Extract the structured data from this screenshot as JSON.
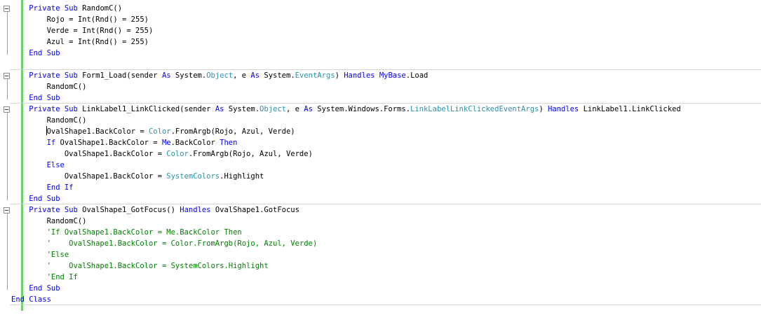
{
  "editor": {
    "lines": [
      [
        {
          "t": "    ",
          "c": "tx"
        },
        {
          "t": "Private Sub",
          "c": "kw"
        },
        {
          "t": " RandomC()",
          "c": "tx"
        }
      ],
      [
        {
          "t": "        Rojo = Int(Rnd() = 255)",
          "c": "tx"
        }
      ],
      [
        {
          "t": "        Verde = Int(Rnd() = 255)",
          "c": "tx"
        }
      ],
      [
        {
          "t": "        Azul = Int(Rnd() = 255)",
          "c": "tx"
        }
      ],
      [
        {
          "t": "    ",
          "c": "tx"
        },
        {
          "t": "End Sub",
          "c": "kw"
        }
      ],
      [],
      [
        {
          "t": "    ",
          "c": "tx"
        },
        {
          "t": "Private Sub",
          "c": "kw"
        },
        {
          "t": " Form1_Load(sender ",
          "c": "tx"
        },
        {
          "t": "As",
          "c": "kw"
        },
        {
          "t": " System.",
          "c": "tx"
        },
        {
          "t": "Object",
          "c": "ty"
        },
        {
          "t": ", e ",
          "c": "tx"
        },
        {
          "t": "As",
          "c": "kw"
        },
        {
          "t": " System.",
          "c": "tx"
        },
        {
          "t": "EventArgs",
          "c": "ty"
        },
        {
          "t": ") ",
          "c": "tx"
        },
        {
          "t": "Handles",
          "c": "kw"
        },
        {
          "t": " ",
          "c": "tx"
        },
        {
          "t": "MyBase",
          "c": "kw"
        },
        {
          "t": ".Load",
          "c": "tx"
        }
      ],
      [
        {
          "t": "        RandomC()",
          "c": "tx"
        }
      ],
      [
        {
          "t": "    ",
          "c": "tx"
        },
        {
          "t": "End Sub",
          "c": "kw"
        }
      ],
      [
        {
          "t": "    ",
          "c": "tx"
        },
        {
          "t": "Private Sub",
          "c": "kw"
        },
        {
          "t": " LinkLabel1_LinkClicked(sender ",
          "c": "tx"
        },
        {
          "t": "As",
          "c": "kw"
        },
        {
          "t": " System.",
          "c": "tx"
        },
        {
          "t": "Object",
          "c": "ty"
        },
        {
          "t": ", e ",
          "c": "tx"
        },
        {
          "t": "As",
          "c": "kw"
        },
        {
          "t": " System.Windows.Forms.",
          "c": "tx"
        },
        {
          "t": "LinkLabelLinkClickedEventArgs",
          "c": "ty"
        },
        {
          "t": ") ",
          "c": "tx"
        },
        {
          "t": "Handles",
          "c": "kw"
        },
        {
          "t": " LinkLabel1.LinkClicked",
          "c": "tx"
        }
      ],
      [
        {
          "t": "        RandomC()",
          "c": "tx"
        }
      ],
      [
        {
          "t": "        ",
          "c": "tx"
        },
        {
          "t": "CARET",
          "c": "caret"
        },
        {
          "t": "OvalShape1.BackColor = ",
          "c": "tx"
        },
        {
          "t": "Color",
          "c": "ty"
        },
        {
          "t": ".FromArgb(Rojo, Azul, Verde)",
          "c": "tx"
        }
      ],
      [
        {
          "t": "        ",
          "c": "tx"
        },
        {
          "t": "If",
          "c": "kw"
        },
        {
          "t": " OvalShape1.BackColor = ",
          "c": "tx"
        },
        {
          "t": "Me",
          "c": "kw"
        },
        {
          "t": ".BackColor ",
          "c": "tx"
        },
        {
          "t": "Then",
          "c": "kw"
        }
      ],
      [
        {
          "t": "            OvalShape1.BackColor = ",
          "c": "tx"
        },
        {
          "t": "Color",
          "c": "ty"
        },
        {
          "t": ".FromArgb(Rojo, Azul, Verde)",
          "c": "tx"
        }
      ],
      [
        {
          "t": "        ",
          "c": "tx"
        },
        {
          "t": "Else",
          "c": "kw"
        }
      ],
      [
        {
          "t": "            OvalShape1.BackColor = ",
          "c": "tx"
        },
        {
          "t": "SystemColors",
          "c": "ty"
        },
        {
          "t": ".Highlight",
          "c": "tx"
        }
      ],
      [
        {
          "t": "        ",
          "c": "tx"
        },
        {
          "t": "End If",
          "c": "kw"
        }
      ],
      [
        {
          "t": "    ",
          "c": "tx"
        },
        {
          "t": "End Sub",
          "c": "kw"
        }
      ],
      [
        {
          "t": "    ",
          "c": "tx"
        },
        {
          "t": "Private Sub",
          "c": "kw"
        },
        {
          "t": " OvalShape1_GotFocus() ",
          "c": "tx"
        },
        {
          "t": "Handles",
          "c": "kw"
        },
        {
          "t": " OvalShape1.GotFocus",
          "c": "tx"
        }
      ],
      [
        {
          "t": "        RandomC()",
          "c": "tx"
        }
      ],
      [
        {
          "t": "        ",
          "c": "tx"
        },
        {
          "t": "'If OvalShape1.BackColor = Me.BackColor Then",
          "c": "cm"
        }
      ],
      [
        {
          "t": "        ",
          "c": "tx"
        },
        {
          "t": "'    OvalShape1.BackColor = Color.FromArgb(Rojo, Azul, Verde)",
          "c": "cm"
        }
      ],
      [
        {
          "t": "        ",
          "c": "tx"
        },
        {
          "t": "'Else",
          "c": "cm"
        }
      ],
      [
        {
          "t": "        ",
          "c": "tx"
        },
        {
          "t": "'    OvalShape1.BackColor = SystemColors.Highlight",
          "c": "cm"
        }
      ],
      [
        {
          "t": "        ",
          "c": "tx"
        },
        {
          "t": "'End If",
          "c": "cm"
        }
      ],
      [
        {
          "t": "    ",
          "c": "tx"
        },
        {
          "t": "End Sub",
          "c": "kw"
        }
      ],
      [
        {
          "t": "End Class",
          "c": "kw"
        }
      ]
    ],
    "collapsible_lines": [
      0,
      6,
      9,
      18
    ],
    "separator_after_lines": [
      5,
      8,
      17,
      26
    ],
    "colors": {
      "keyword": "#0000ff",
      "type": "#2b91af",
      "comment": "#008000",
      "text": "#000000",
      "change_marker": "#6ccf6c"
    },
    "icons": {
      "collapse": "collapse-minus-icon"
    }
  }
}
